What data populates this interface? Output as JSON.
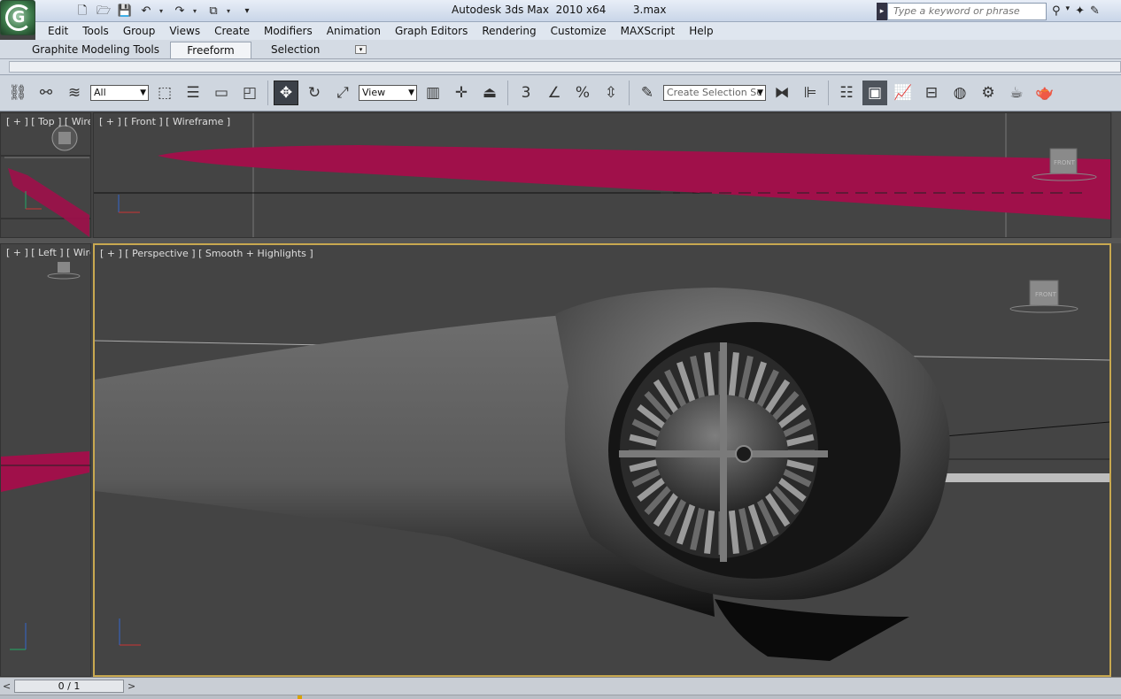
{
  "window": {
    "title": "Autodesk 3ds Max  2010 x64        3.max"
  },
  "quick_access": {
    "icons": [
      "new-file-icon",
      "open-folder-icon",
      "save-icon",
      "undo-icon",
      "redo-icon",
      "project-folder-icon"
    ]
  },
  "search": {
    "placeholder": "Type a keyword or phrase"
  },
  "menu": [
    "Edit",
    "Tools",
    "Group",
    "Views",
    "Create",
    "Modifiers",
    "Animation",
    "Graph Editors",
    "Rendering",
    "Customize",
    "MAXScript",
    "Help"
  ],
  "ribbon": {
    "title": "Graphite Modeling Tools",
    "tabs": [
      "Freeform",
      "Selection"
    ],
    "active_tab": "Freeform"
  },
  "toolbar": {
    "selection_filter": "All",
    "reference_coord": "View",
    "named_selection": "Create Selection Se",
    "snap_label": "3"
  },
  "viewports": {
    "top": {
      "label": "[ + ] [ Top ] [ Wirefr"
    },
    "front": {
      "label": "[ + ] [ Front ] [ Wireframe ]"
    },
    "left": {
      "label": "[ + ] [ Left ] [ Wirefr"
    },
    "perspective": {
      "label": "[ + ] [ Perspective ] [ Smooth + Highlights ]"
    },
    "viewcube_label": "FRONT"
  },
  "colors": {
    "wireframe": "#a0104a",
    "active_viewport": "#c8a850",
    "viewport_bg": "#444444"
  },
  "timeline": {
    "frame": "0 / 1",
    "prev": "<",
    "next": ">"
  }
}
